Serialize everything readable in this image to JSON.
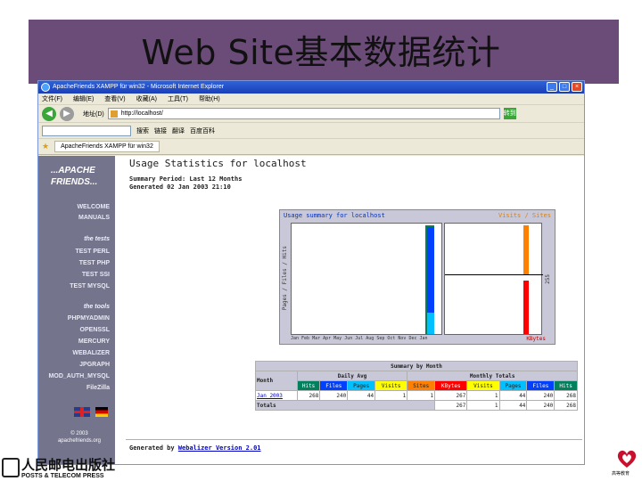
{
  "slide": {
    "title": "Web Site基本数据统计"
  },
  "browser": {
    "window_title": "ApacheFriends XAMPP für win32 - Microsoft Internet Explorer",
    "menu": [
      "文件(F)",
      "编辑(E)",
      "查看(V)",
      "收藏(A)",
      "工具(T)",
      "帮助(H)"
    ],
    "address_label": "地址(D)",
    "address_value": "http://localhost/",
    "go_label": "转到",
    "links": [
      "搜索",
      "链接",
      "翻译",
      "百度百科"
    ],
    "tab_label": "ApacheFriends XAMPP für win32"
  },
  "sidebar": {
    "logo_line1": "...APACHE",
    "logo_line2": "FRIENDS...",
    "items": [
      "WELCOME",
      "MANUALS",
      "the tests",
      "TEST PERL",
      "TEST PHP",
      "TEST SSI",
      "TEST MYSQL",
      "the tools",
      "PHPMYADMIN",
      "OPENSSL",
      "MERCURY",
      "WEBALIZER",
      "JPGRAPH",
      "MOD_AUTH_MYSQL",
      "FileZilla"
    ],
    "copyright": "© 2003",
    "site": "apachefriends.org"
  },
  "page": {
    "heading": "Usage Statistics for localhost",
    "period": "Summary Period: Last 12 Months",
    "generated": "Generated 02 Jan 2003 21:10",
    "footer_prefix": "Generated by",
    "footer_link": "Webalizer Version 2.01"
  },
  "chart": {
    "title": "Usage summary for localhost",
    "legend": "Visits / Sites",
    "y_axis_label": "Pages / Files / Hits",
    "months": "Jan Feb Mar Apr May Jun Jul Aug Sep Oct Nov Dec Jan",
    "right_unit": "KBytes",
    "right_value": "255"
  },
  "chart_data": {
    "type": "bar",
    "title": "Usage summary for localhost",
    "series": [
      {
        "name": "Hits",
        "values": [
          268
        ]
      },
      {
        "name": "Files",
        "values": [
          240
        ]
      },
      {
        "name": "Pages",
        "values": [
          44
        ]
      }
    ],
    "categories": [
      "Jan 2003"
    ]
  },
  "summary": {
    "title": "Summary by Month",
    "daily_avg": "Daily Avg",
    "monthly_totals": "Monthly Totals",
    "month_col": "Month",
    "cols": [
      "Hits",
      "Files",
      "Pages",
      "Visits",
      "Sites",
      "KBytes",
      "Visits",
      "Pages",
      "Files",
      "Hits"
    ],
    "row": [
      "Jan 2003",
      "268",
      "240",
      "44",
      "1",
      "1",
      "267",
      "1",
      "44",
      "240",
      "268"
    ],
    "totals_label": "Totals",
    "totals": [
      "267",
      "1",
      "44",
      "240",
      "268"
    ]
  },
  "publisher": {
    "cn": "人民邮电出版社",
    "en": "POSTS & TELECOM PRESS"
  },
  "seal_text": "高等教育"
}
